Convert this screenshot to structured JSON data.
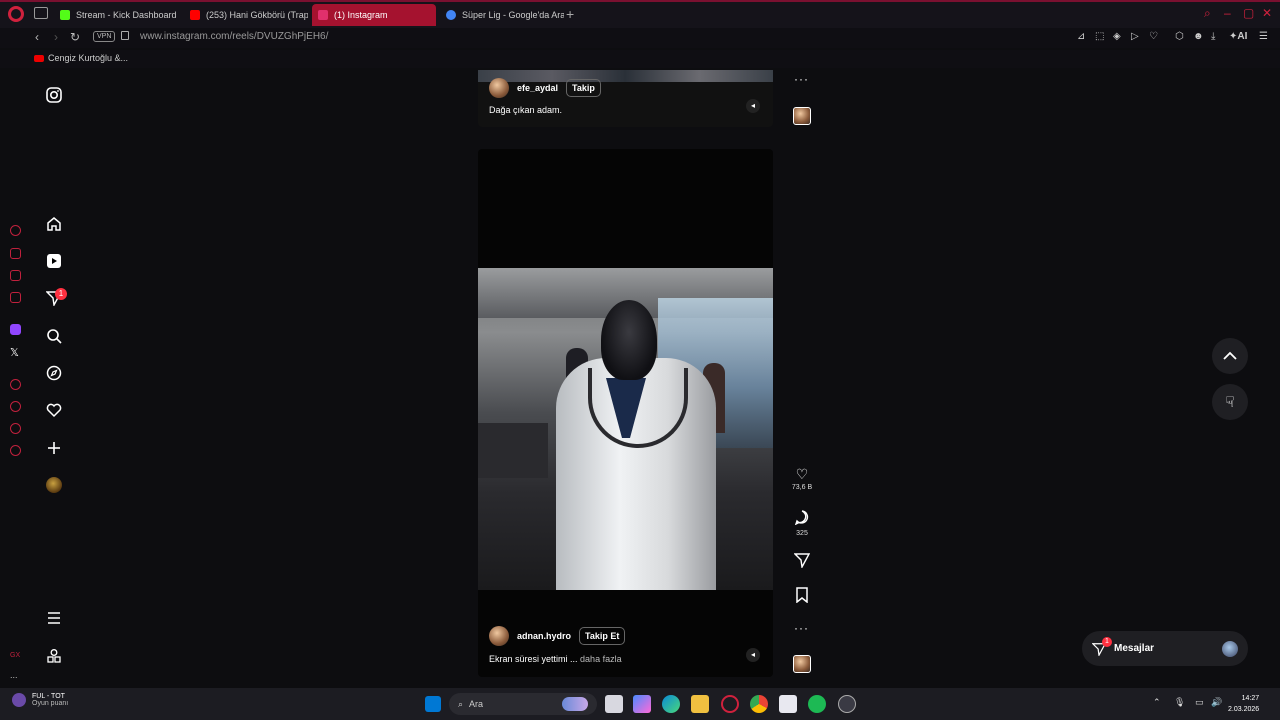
{
  "browser": {
    "tabs": [
      {
        "label": "Stream - Kick Dashboard",
        "color": "#53fc18"
      },
      {
        "label": "(253) Hani Gökbörü (Trap",
        "color": "#ff0000"
      },
      {
        "label": "(1) Instagram",
        "color": "#e1306c"
      },
      {
        "label": "Süper Lig - Google'da Ara",
        "color": "#4285f4"
      }
    ],
    "vpn_label": "VPN",
    "url": "www.instagram.com/reels/DVUZGhPjEH6/",
    "ai_label": "AI",
    "bookmark": "Cengiz Kurtoğlu &..."
  },
  "opera_sidebar": {
    "gx_label": "GX",
    "more_label": "..."
  },
  "instagram": {
    "notifications_badge": "1",
    "reels": [
      {
        "username": "efe_aydal",
        "follow_label": "Takip",
        "caption": "Dağa çıkan adam."
      },
      {
        "username": "adnan.hydro",
        "follow_label": "Takip Et",
        "caption": "Ekran süresi yettimi ...",
        "more_label": "daha fazla",
        "likes": "73,6 B",
        "comments": "325"
      }
    ],
    "messages": {
      "label": "Mesajlar",
      "badge": "1"
    }
  },
  "taskbar": {
    "weather_title": "FUL - TOT",
    "weather_sub": "Oyun puanı",
    "search_placeholder": "Ara",
    "time": "14:27",
    "date": "2.03.2026"
  }
}
